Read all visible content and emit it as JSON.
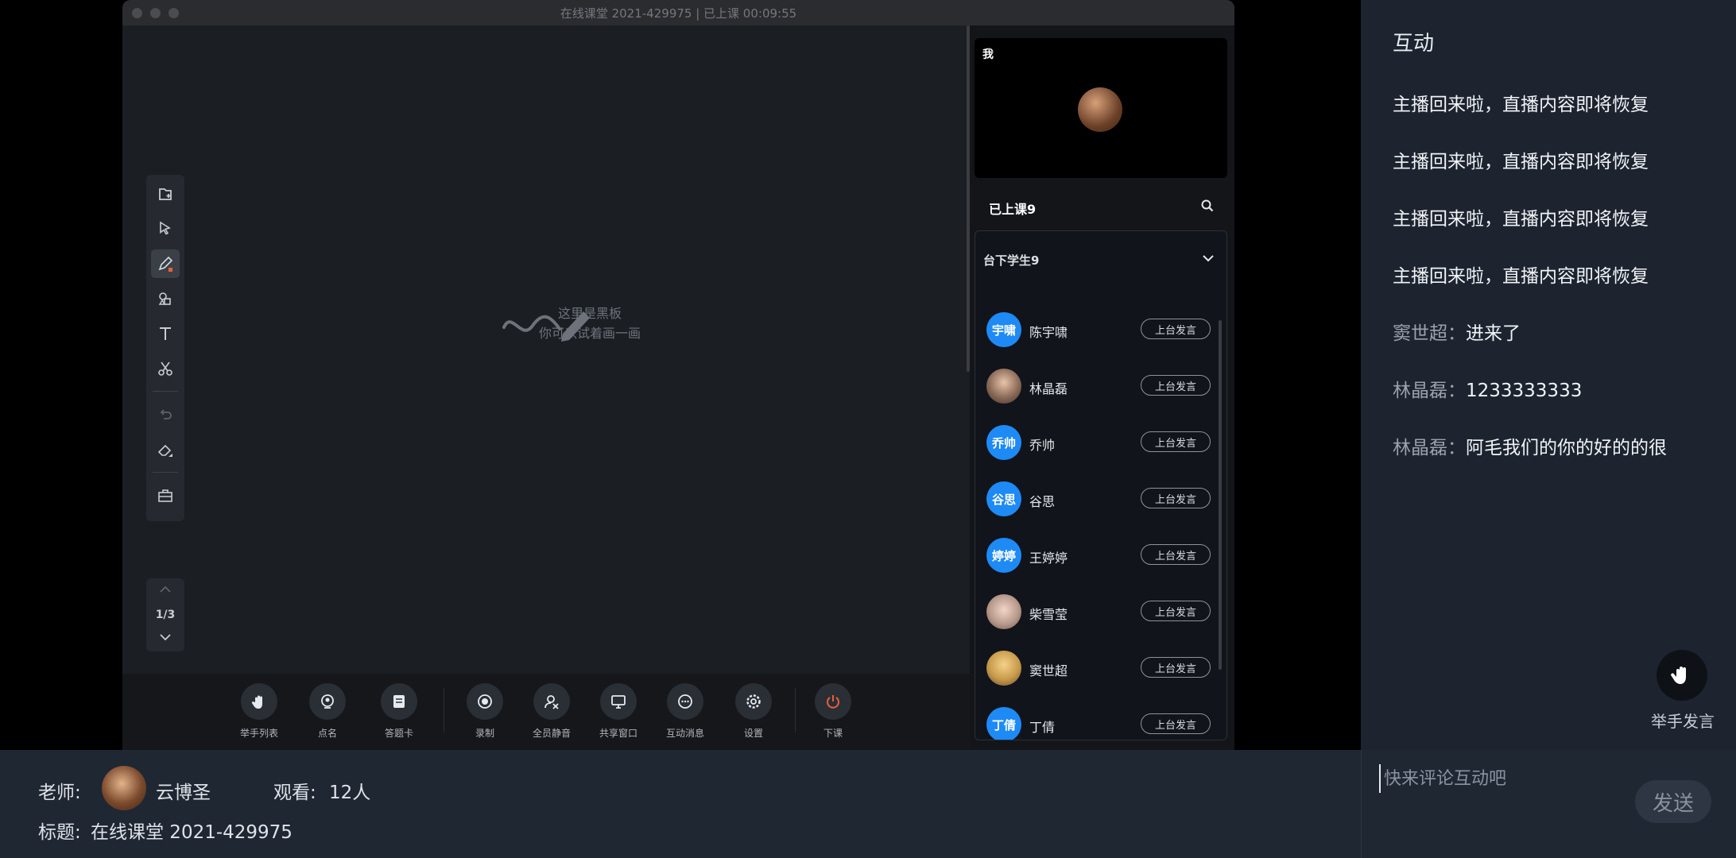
{
  "window": {
    "title": "在线课堂 2021-429975 | 已上课 00:09:55"
  },
  "board": {
    "hint_line1": "这里是黑板",
    "hint_line2": "你可以试着画一画",
    "page_indicator": "1/3"
  },
  "tools": [
    "add-page-icon",
    "select-arrow-icon",
    "pen-icon",
    "shapes-icon",
    "text-icon",
    "scissors-icon",
    "undo-icon",
    "eraser-icon",
    "toolbox-icon"
  ],
  "bottom_buttons": [
    {
      "label": "举手列表",
      "icon": "hand-icon"
    },
    {
      "label": "点名",
      "icon": "location-pin-icon"
    },
    {
      "label": "答题卡",
      "icon": "answer-card-icon"
    },
    {
      "label": "录制",
      "icon": "record-icon"
    },
    {
      "label": "全员静音",
      "icon": "mute-all-icon"
    },
    {
      "label": "共享窗口",
      "icon": "share-screen-icon"
    },
    {
      "label": "互动消息",
      "icon": "chat-bubble-icon"
    },
    {
      "label": "设置",
      "icon": "gear-icon"
    },
    {
      "label": "下课",
      "icon": "power-icon"
    }
  ],
  "self_cam": {
    "label": "我"
  },
  "roster": {
    "in_class_label": "已上课9",
    "students_label": "台下学生9",
    "stage_button": "上台发言",
    "students": [
      {
        "avatar": "宇啸",
        "name": "陈宇啸"
      },
      {
        "avatar": "",
        "name": "林晶磊"
      },
      {
        "avatar": "乔帅",
        "name": "乔帅"
      },
      {
        "avatar": "谷思",
        "name": "谷思"
      },
      {
        "avatar": "婷婷",
        "name": "王婷婷"
      },
      {
        "avatar": "",
        "name": "柴雪莹"
      },
      {
        "avatar": "",
        "name": "窦世超"
      },
      {
        "avatar": "丁倩",
        "name": "丁倩"
      }
    ]
  },
  "chat": {
    "title": "互动",
    "messages": [
      {
        "who": "",
        "text": "主播回来啦，直播内容即将恢复"
      },
      {
        "who": "",
        "text": "主播回来啦，直播内容即将恢复"
      },
      {
        "who": "",
        "text": "主播回来啦，直播内容即将恢复"
      },
      {
        "who": "",
        "text": "主播回来啦，直播内容即将恢复"
      },
      {
        "who": "窦世超：",
        "text": "进来了"
      },
      {
        "who": "林晶磊：",
        "text": "1233333333"
      },
      {
        "who": "林晶磊：",
        "text": "阿毛我们的你的好的的很"
      }
    ],
    "raise_hand_label": "举手发言",
    "input_placeholder": "快来评论互动吧",
    "send_label": "发送"
  },
  "footer": {
    "teacher_label": "老师:",
    "teacher_name": "云博圣",
    "viewers_label": "观看:",
    "viewers_value": "12人",
    "title_label": "标题:",
    "title_value": "在线课堂 2021-429975"
  },
  "colors": {
    "accent_blue": "#1e8af6",
    "danger": "#e8603a"
  }
}
